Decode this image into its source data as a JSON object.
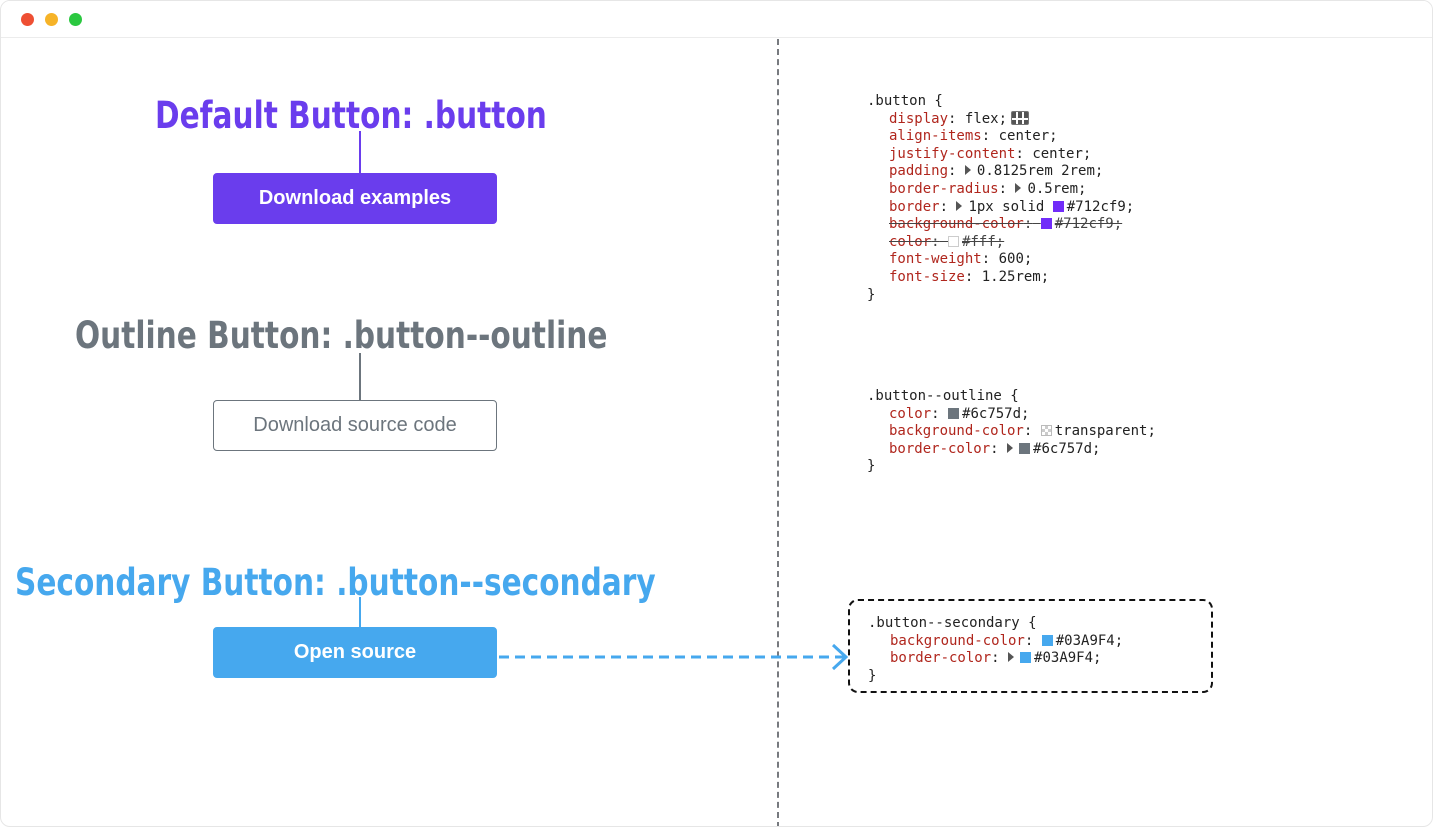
{
  "window": {
    "traffic_lights": [
      "close",
      "minimize",
      "zoom"
    ]
  },
  "sections": {
    "default": {
      "heading": "Default Button: .button",
      "button_label": "Download examples",
      "color": "#6a3ded"
    },
    "outline": {
      "heading": "Outline Button: .button--outline",
      "button_label": "Download source code",
      "color": "#6c757d"
    },
    "secondary": {
      "heading": "Secondary Button: .button--secondary",
      "button_label": "Open source",
      "color": "#46a8ee"
    }
  },
  "code": {
    "button": {
      "selector": ".button {",
      "close": "}",
      "decls": {
        "display": {
          "prop": "display",
          "value": "flex;"
        },
        "align_items": {
          "prop": "align-items",
          "value": "center;"
        },
        "justify_content": {
          "prop": "justify-content",
          "value": "center;"
        },
        "padding": {
          "prop": "padding",
          "value": "0.8125rem 2rem;"
        },
        "border_radius": {
          "prop": "border-radius",
          "value": "0.5rem;"
        },
        "border": {
          "prop": "border",
          "value": "1px solid",
          "color_value": "#712cf9;"
        },
        "background_color": {
          "prop": "background-color",
          "value": "#712cf9;"
        },
        "color": {
          "prop": "color",
          "value": "#fff;"
        },
        "font_weight": {
          "prop": "font-weight",
          "value": "600;"
        },
        "font_size": {
          "prop": "font-size",
          "value": "1.25rem;"
        }
      }
    },
    "outline": {
      "selector": ".button--outline {",
      "close": "}",
      "decls": {
        "color": {
          "prop": "color",
          "value": "#6c757d;"
        },
        "background_color": {
          "prop": "background-color",
          "value": "transparent;"
        },
        "border_color": {
          "prop": "border-color",
          "value": "#6c757d;"
        }
      }
    },
    "secondary": {
      "selector": ".button--secondary {",
      "close": "}",
      "decls": {
        "background_color": {
          "prop": "background-color",
          "value": "#03A9F4;"
        },
        "border_color": {
          "prop": "border-color",
          "value": "#03A9F4;"
        }
      }
    }
  },
  "swatches": {
    "purple": "#712cf9",
    "white": "#ffffff",
    "gray": "#6c757d",
    "blue": "#03A9F4"
  },
  "colon": ":"
}
